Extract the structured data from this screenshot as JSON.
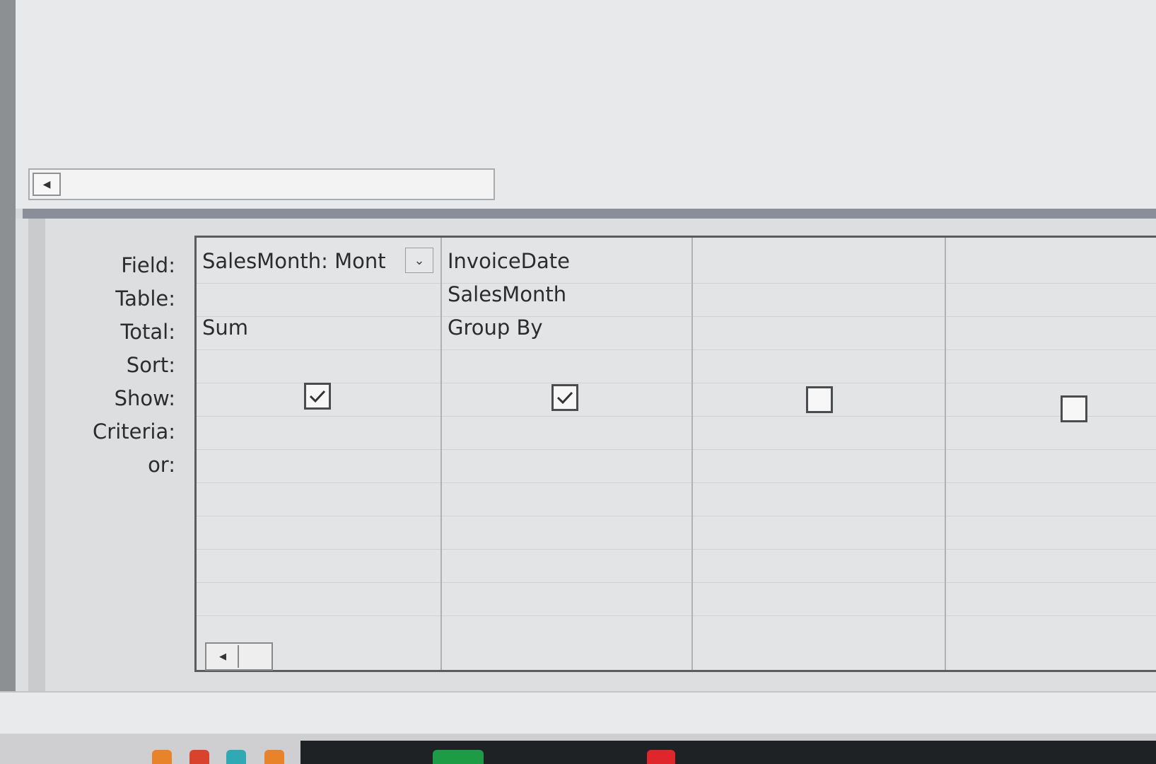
{
  "colors": {
    "icon_orange": "#e8832a",
    "icon_red": "#d9432e",
    "icon_teal": "#2fa9b3",
    "icon_green": "#1e9b45",
    "icon_red2": "#e0262b"
  },
  "query_grid": {
    "row_labels": [
      "Field:",
      "Table:",
      "Total:",
      "Sort:",
      "Show:",
      "Criteria:",
      "or:"
    ],
    "columns": [
      {
        "field": "SalesMonth: Mont",
        "table": "",
        "total": "Sum",
        "sort": "",
        "show": true,
        "criteria": ""
      },
      {
        "field": "InvoiceDate",
        "table": "SalesMonth",
        "total": "Group By",
        "sort": "",
        "show": true,
        "criteria": ""
      },
      {
        "field": "",
        "table": "",
        "total": "",
        "sort": "",
        "show": false,
        "criteria": ""
      },
      {
        "field": "",
        "table": "",
        "total": "",
        "sort": "",
        "show": false,
        "criteria": ""
      }
    ]
  },
  "icons": {
    "field_dropdown": "chevron-down-icon",
    "scroll_left": "triangle-left-icon",
    "checkmark": "checkmark-icon"
  }
}
